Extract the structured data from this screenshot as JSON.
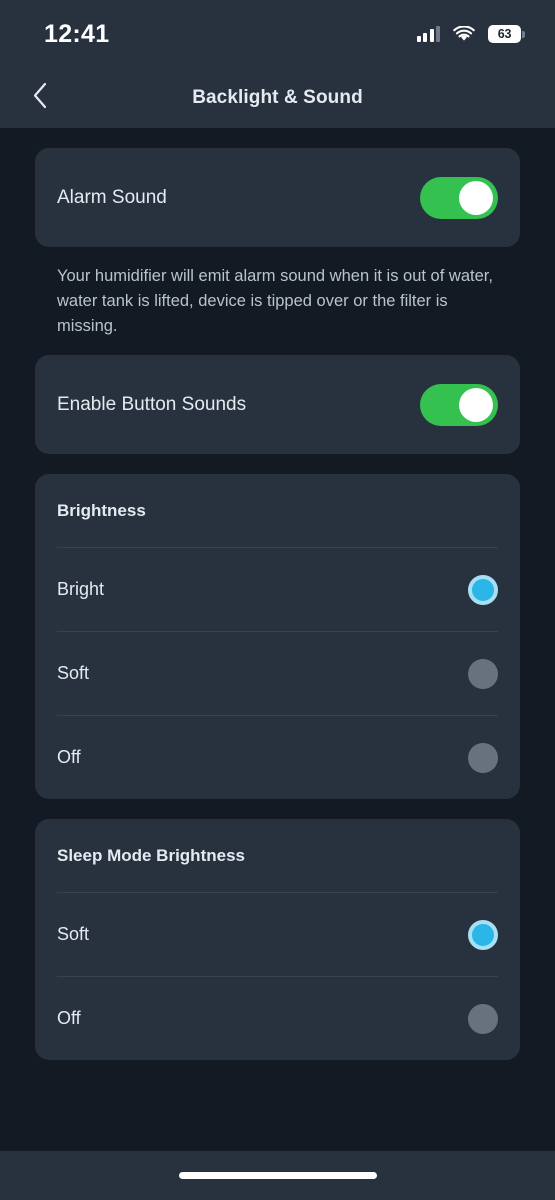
{
  "status_bar": {
    "time": "12:41",
    "signal_icon": "cellular-signal-icon",
    "wifi_icon": "wifi-icon",
    "battery_level": "63",
    "battery_icon": "battery-icon"
  },
  "nav": {
    "back_icon": "chevron-left-icon",
    "title": "Backlight & Sound"
  },
  "alarm_sound": {
    "label": "Alarm Sound",
    "toggle_state": "on",
    "description": "Your humidifier will emit alarm sound when it is out of water, water tank is lifted, device is tipped over or the filter is missing."
  },
  "button_sounds": {
    "label": "Enable Button Sounds",
    "toggle_state": "on"
  },
  "brightness": {
    "title": "Brightness",
    "options": [
      {
        "label": "Bright",
        "selected": true
      },
      {
        "label": "Soft",
        "selected": false
      },
      {
        "label": "Off",
        "selected": false
      }
    ]
  },
  "sleep_mode_brightness": {
    "title": "Sleep Mode Brightness",
    "options": [
      {
        "label": "Soft",
        "selected": true
      },
      {
        "label": "Off",
        "selected": false
      }
    ]
  },
  "home_bar": {
    "indicator": "home-indicator"
  },
  "colors": {
    "page_background": "#141a24",
    "card_background": "#28323f",
    "chrome_background": "#28323f",
    "toggle_on": "#34c14f",
    "radio_selected": "#2ab6e8",
    "radio_selected_ring": "#a9dff2",
    "radio_unselected": "#68727f",
    "text_primary": "#e4eaf0",
    "text_secondary": "#b8c3ce",
    "divider": "#39434f"
  }
}
